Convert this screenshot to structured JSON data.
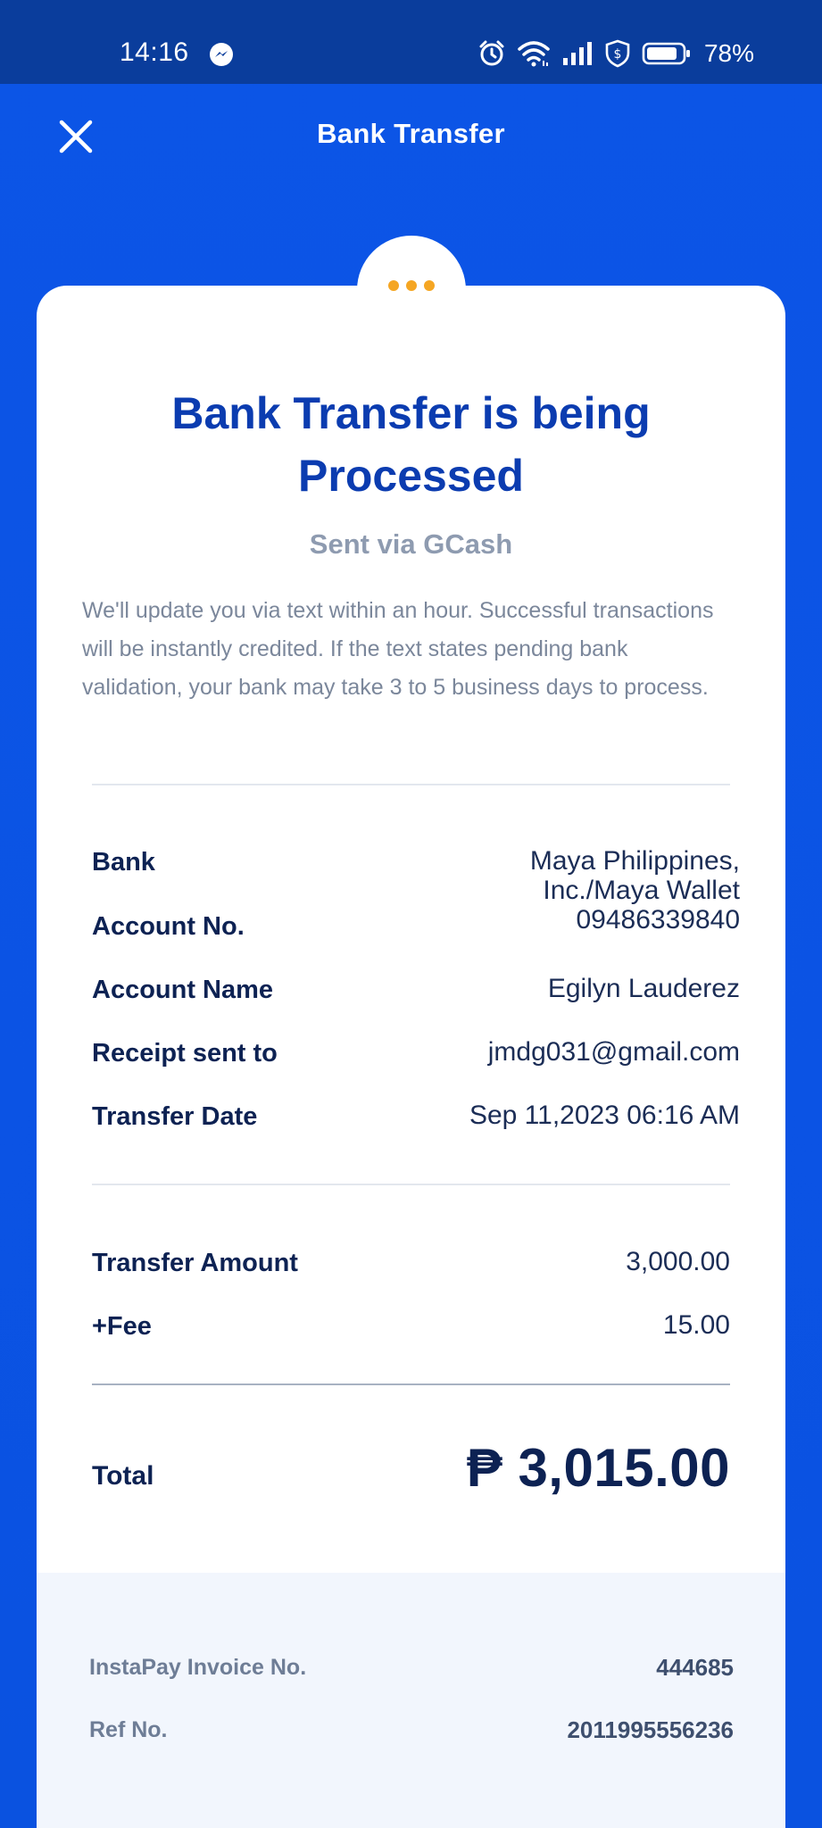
{
  "status_bar": {
    "time": "14:16",
    "battery": "78%",
    "icons": [
      "messenger-icon",
      "alarm-icon",
      "wifi-icon",
      "signal-icon",
      "shield-icon",
      "battery-icon"
    ]
  },
  "header": {
    "title": "Bank Transfer",
    "close_icon": "close-icon"
  },
  "status_indicator": {
    "icon": "processing-dots-icon",
    "color": "#f5a623"
  },
  "card": {
    "headline": "Bank Transfer is being Processed",
    "sub_headline": "Sent via GCash",
    "description": "We'll update you via text within an hour. Successful transactions will be instantly credited. If the text states pending bank validation, your bank may take 3 to 5 business days to process.",
    "details": [
      {
        "label": "Bank",
        "value_lines": [
          "Maya Philippines,",
          "Inc./Maya Wallet"
        ]
      },
      {
        "label": "Account No.",
        "value": "09486339840"
      },
      {
        "label": "Account Name",
        "value": "Egilyn Lauderez"
      },
      {
        "label": "Receipt sent to",
        "value": "jmdg031@gmail.com"
      },
      {
        "label": "Transfer Date",
        "value": "Sep 11,2023 06:16 AM"
      }
    ],
    "amounts": [
      {
        "label": "Transfer Amount",
        "value": "3,000.00"
      },
      {
        "label": "+Fee",
        "value": "15.00"
      }
    ],
    "total": {
      "label": "Total",
      "value": "₱ 3,015.00"
    },
    "references": [
      {
        "label": "InstaPay Invoice No.",
        "value": "444685"
      },
      {
        "label": "Ref No.",
        "value": "2011995556236"
      }
    ]
  },
  "colors": {
    "brand_blue": "#0b53e4",
    "status_bar": "#0a3d9c",
    "headline": "#0b3cb0",
    "text_dark": "#0d2253",
    "accent_orange": "#f5a623"
  }
}
